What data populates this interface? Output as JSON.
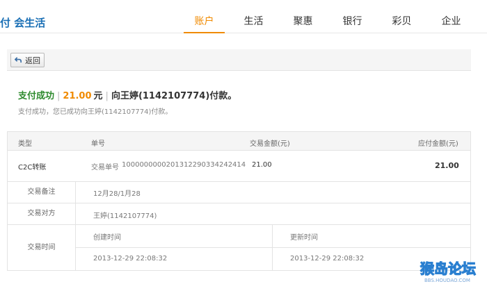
{
  "logo": {
    "text": "付 会生活"
  },
  "nav": {
    "items": [
      {
        "label": "账户",
        "active": true
      },
      {
        "label": "生活",
        "active": false
      },
      {
        "label": "聚惠",
        "active": false
      },
      {
        "label": "银行",
        "active": false
      },
      {
        "label": "彩贝",
        "active": false
      },
      {
        "label": "企业",
        "active": false
      }
    ]
  },
  "toolbar": {
    "back_label": "返回"
  },
  "result": {
    "status": "支付成功",
    "separator": "|",
    "amount": "21.00",
    "currency": "元",
    "recipient": "向王婷(1142107774)付款。",
    "subline": "支付成功，您已成功向王婷(1142107774)付款。"
  },
  "table": {
    "headers": {
      "type": "类型",
      "order": "单号",
      "amount": "交易金额(元)",
      "payable": "应付金额(元)"
    },
    "row": {
      "type": "C2C转账",
      "order_label": "交易单号",
      "order_no": "1000000000201312290334242414",
      "amount": "21.00",
      "payable": "21.00"
    },
    "remark": {
      "label": "交易备注",
      "value": "12月28/1月28"
    },
    "counterparty": {
      "label": "交易对方",
      "value": "王婷(1142107774)"
    },
    "time": {
      "label": "交易时间",
      "created_label": "创建时间",
      "created_value": "2013-12-29 22:08:32",
      "updated_label": "更新时间",
      "updated_value": "2013-12-29 22:08:32"
    }
  },
  "watermark": {
    "text": "猴岛论坛",
    "sub": "BBS.HOUDAO.COM"
  },
  "colors": {
    "accent": "#f08a00",
    "success": "#2d8a2d",
    "logo": "#1a6fb5"
  }
}
